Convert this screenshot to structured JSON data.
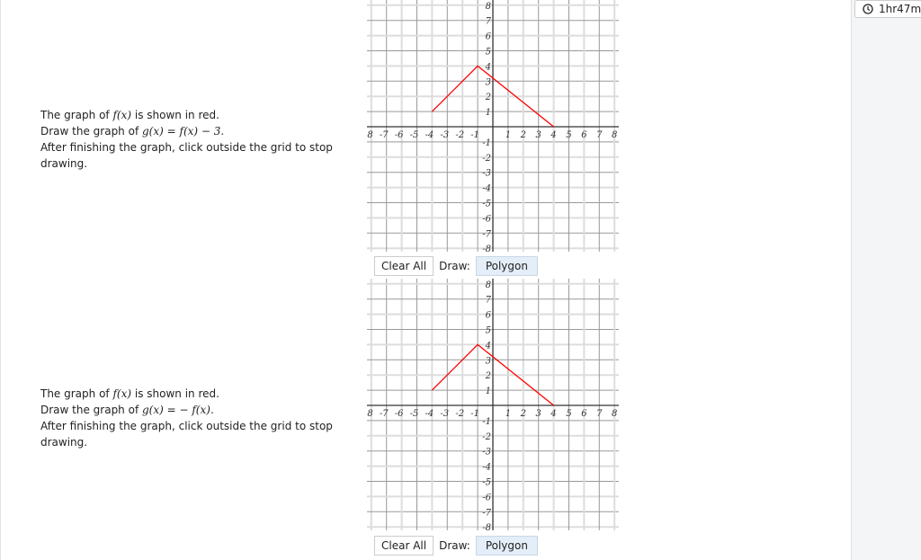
{
  "timer": {
    "icon": "clock-icon",
    "text": "1hr47m"
  },
  "questions": [
    {
      "line1_pre": "The graph of ",
      "f": "f(x)",
      "line1_post": " is shown in red.",
      "line2_pre": "Draw the graph of ",
      "g": "g(x) = f(x) − 3.",
      "line3": "After finishing the graph, click outside the grid to stop drawing.",
      "clear_label": "Clear All",
      "draw_label": "Draw:",
      "mode_label": "Polygon"
    },
    {
      "line1_pre": "The graph of ",
      "f": "f(x)",
      "line1_post": " is shown in red.",
      "line2_pre": "Draw the graph of ",
      "g": "g(x) =  − f(x).",
      "line3": "After finishing the graph, click outside the grid to stop drawing.",
      "clear_label": "Clear All",
      "draw_label": "Draw:",
      "mode_label": "Polygon"
    }
  ],
  "chart_data": [
    {
      "type": "line",
      "xlim": [
        -8,
        8
      ],
      "ylim": [
        -8,
        8
      ],
      "grid": true,
      "x_ticks": [
        "-8",
        "-7",
        "-6",
        "-5",
        "-4",
        "-3",
        "-2",
        "-1",
        "1",
        "2",
        "3",
        "4",
        "5",
        "6",
        "7",
        "8"
      ],
      "y_ticks": [
        "8",
        "7",
        "6",
        "5",
        "4",
        "3",
        "2",
        "1",
        "-1",
        "-2",
        "-3",
        "-4",
        "-5",
        "-6",
        "-7",
        "-8"
      ],
      "series": [
        {
          "color": "#ff0000",
          "points": [
            [
              -4,
              1
            ],
            [
              -1,
              4
            ],
            [
              4,
              0
            ]
          ]
        }
      ]
    },
    {
      "type": "line",
      "xlim": [
        -8,
        8
      ],
      "ylim": [
        -8,
        8
      ],
      "grid": true,
      "x_ticks": [
        "-8",
        "-7",
        "-6",
        "-5",
        "-4",
        "-3",
        "-2",
        "-1",
        "1",
        "2",
        "3",
        "4",
        "5",
        "6",
        "7",
        "8"
      ],
      "y_ticks": [
        "8",
        "7",
        "6",
        "5",
        "4",
        "3",
        "2",
        "1",
        "-1",
        "-2",
        "-3",
        "-4",
        "-5",
        "-6",
        "-7",
        "-8"
      ],
      "series": [
        {
          "color": "#ff0000",
          "points": [
            [
              -4,
              1
            ],
            [
              -1,
              4
            ],
            [
              4,
              0
            ]
          ]
        }
      ]
    }
  ]
}
